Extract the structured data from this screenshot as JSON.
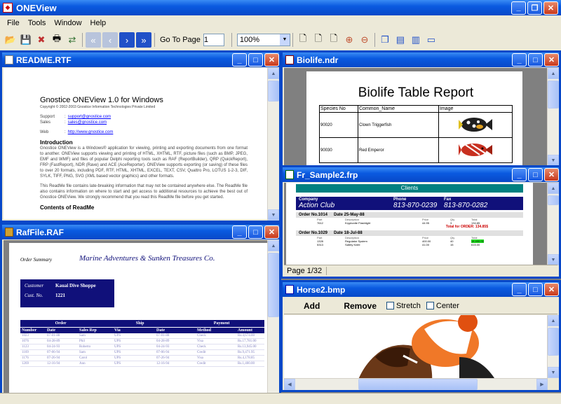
{
  "app": {
    "title": "ONEView"
  },
  "menu": [
    "File",
    "Tools",
    "Window",
    "Help"
  ],
  "toolbar": {
    "goto_label": "Go To Page",
    "page_value": "1",
    "zoom_value": "100%"
  },
  "icons": [
    "open-icon",
    "save-icon",
    "close-doc-icon",
    "print-icon",
    "export-icon",
    "first-page-icon",
    "prev-page-icon",
    "next-page-icon",
    "last-page-icon",
    "fit-page-icon",
    "fit-width-icon",
    "actual-size-icon",
    "zoom-in-icon",
    "zoom-out-icon",
    "cascade-icon",
    "tile-horizontal-icon",
    "tile-vertical-icon",
    "minimize-all-icon"
  ],
  "readme": {
    "title": "README.RTF",
    "heading": "Gnostice ONEView 1.0 for Windows",
    "copyright": "Copyright © 2002-2003 Gnostice Information Technologies Private Limited",
    "support_label": "Support",
    "support_value": "support@gnostice.com",
    "sales_label": "Sales",
    "sales_value": "sales@gnostice.com",
    "web_label": "Web",
    "web_value": "http://www.gnostice.com",
    "intro_heading": "Introduction",
    "intro_text": "Gnostice ONEView is a Windows® application for viewing, printing and exporting documents from one format to another. ONEView supports viewing and printing of HTML, XHTML, RTF, picture files (such as BMP, JPEG, EMF and WMF) and files of popular Delphi reporting tools such as RAF (ReportBuilder), QRP (QuickReport), FRP (FastReport), NDR (Rave) and ACE (AceReporter). ONEView supports exporting (or saving) of these files to over 20 formats, including PDF, RTF, HTML, XHTML, EXCEL, TEXT, CSV, Quattro Pro, LOTUS 1-2-3, DIF, SYLK, TIFF, PNG, SVG (XML based vector graphics) and other formats.",
    "readme_text": "This ReadMe file contains late-breaking information that may not be contained anywhere else. The ReadMe file also contains information on where to start and get access to additional resources to achieve the best out of Gnostice ONEView. We strongly recommend that you read this ReadMe file before you get started.",
    "contents_heading": "Contents of ReadMe"
  },
  "biolife": {
    "title": "Biolife.ndr",
    "report_title": "Biolife Table Report",
    "headers": [
      "Species No",
      "Common_Name",
      "Image"
    ],
    "rows": [
      [
        "90020",
        "Clown Triggerfish"
      ],
      [
        "90030",
        "Red Emperor"
      ]
    ]
  },
  "fr_sample": {
    "title": "Fr_Sample2.frp",
    "banner": "Clients",
    "headers": [
      "Company",
      "Phone",
      "Fax"
    ],
    "company": "Action Club",
    "phone": "813-870-0239",
    "fax": "813-870-0282",
    "order1": "Order No.1014",
    "date1": "Date 25-May-88",
    "order2": "Order No.1029",
    "date2": "Date 18-Jul-88",
    "sub_headers": [
      "Part",
      "Description",
      "Price",
      "Qty",
      "Total"
    ],
    "line1": [
      "7612",
      "Kryptonite Flashlight",
      "44.95",
      "3",
      "134.85"
    ],
    "total_label": "Total for ORDER: 134.85$",
    "line2": [
      "1328",
      "Regulator System",
      "400.00",
      "40",
      "14,400.00"
    ],
    "line3": [
      "5313",
      "Safety Knife",
      "41.00",
      "15",
      "615.00"
    ],
    "status": "Page 1/32"
  },
  "raf": {
    "title": "RafFile.RAF",
    "order_summary": "Order Summary",
    "company": "Marine Adventures & Sunken Treasures Co.",
    "customer_label": "Customer",
    "customer_value": "Kauai Dive Shoppe",
    "custno_label": "Cust. No.",
    "custno_value": "1221",
    "group_order": "Order",
    "group_ship": "Ship",
    "group_payment": "Payment",
    "headers": [
      "Number",
      "Date",
      "Sales Rep",
      "Via",
      "Date",
      "Method",
      "Amount"
    ],
    "rows": [
      [
        "1023",
        "07-01-88",
        "Sam",
        "UPS",
        "07-01-88",
        "Check",
        "Rs.4,674.00"
      ],
      [
        "1076",
        "04-28-89",
        "Phil",
        "UPS",
        "04-28-89",
        "Visa",
        "Rs.17,781.00"
      ],
      [
        "1123",
        "04-24-93",
        "Roberto",
        "UPS",
        "04-24-93",
        "Check",
        "Rs.13,945.00"
      ],
      [
        "1169",
        "07-06-94",
        "Sam",
        "UPS",
        "07-06-94",
        "Credit",
        "Rs.9,471.95"
      ],
      [
        "1176",
        "07-26-94",
        "Carol",
        "UPS",
        "07-26-94",
        "Visa",
        "Rs.4,178.85"
      ],
      [
        "1269",
        "12-16-94",
        "Ann",
        "UPS",
        "12-16-94",
        "Credit",
        "Rs.1,400.00"
      ]
    ]
  },
  "horse": {
    "title": "Horse2.bmp",
    "add_label": "Add",
    "remove_label": "Remove",
    "stretch_label": "Stretch",
    "center_label": "Center"
  }
}
